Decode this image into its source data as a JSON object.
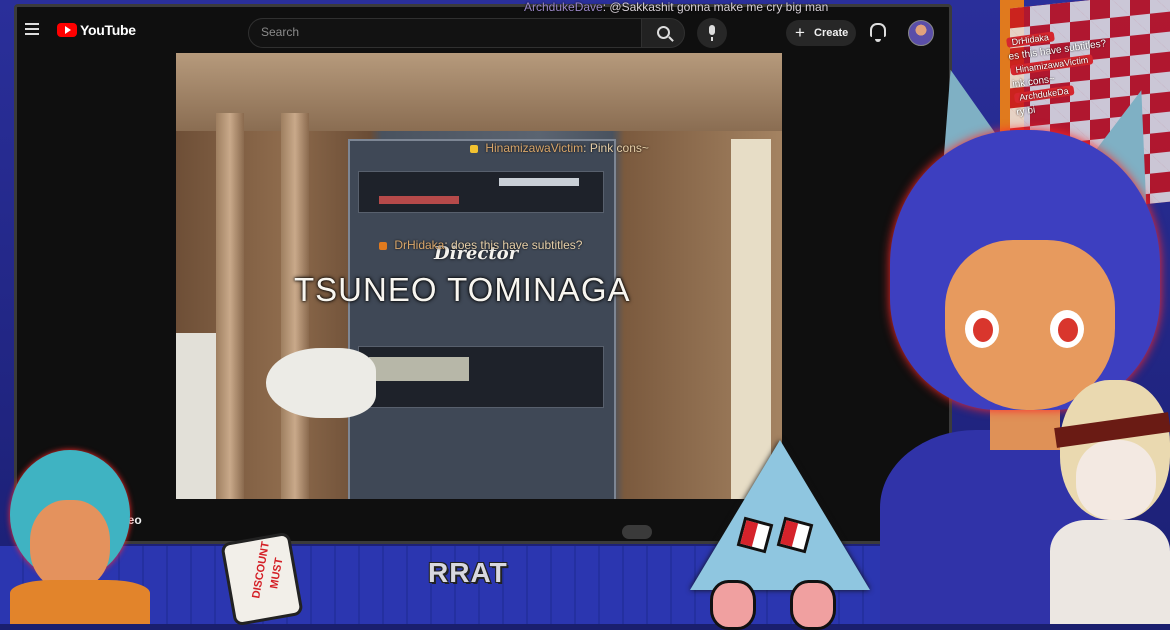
{
  "youtube": {
    "logo_text": "YouTube",
    "search_placeholder": "Search",
    "create_label": "Create",
    "plus_glyph": "+",
    "icons": [
      "menu-icon",
      "youtube-logo-icon",
      "search-icon",
      "mic-icon",
      "bell-icon",
      "avatar"
    ]
  },
  "video": {
    "credit_role": "Director",
    "credit_name": "TSUNEO TOMINAGA",
    "title_partial": "ideo"
  },
  "video_chat": [
    {
      "user": "HinamizawaVictim",
      "sep": ":",
      "text": "Pink cons~",
      "color": "#f2c230"
    },
    {
      "user": "DrHidaka",
      "sep": ":",
      "text": "does this have subtitles?",
      "color": "#e07a1e"
    }
  ],
  "top_chat": {
    "user": "ArchdukeDave",
    "sep": ":",
    "text": "@Sakkashit gonna make me cry big man"
  },
  "side_chat": [
    {
      "text": "DrHidaka",
      "pill": true
    },
    {
      "text": "es this have subtitles?",
      "pill": false
    },
    {
      "text": "HinamizawaVictim",
      "pill": true
    },
    {
      "text": "ink cons~",
      "pill": false
    },
    {
      "text": "ArchdukeDa",
      "pill": true
    },
    {
      "text": "ry bi",
      "pill": false
    }
  ],
  "overlay": {
    "rrat_label": "RRAT",
    "sticker_line1": "DISCOUNT",
    "sticker_line2": "MUST"
  },
  "colors": {
    "frame_blue": "#1b1f73",
    "accent_red": "#d6262e",
    "youtube_red": "#ff0000",
    "main_char_hair": "#3d3fc0"
  }
}
